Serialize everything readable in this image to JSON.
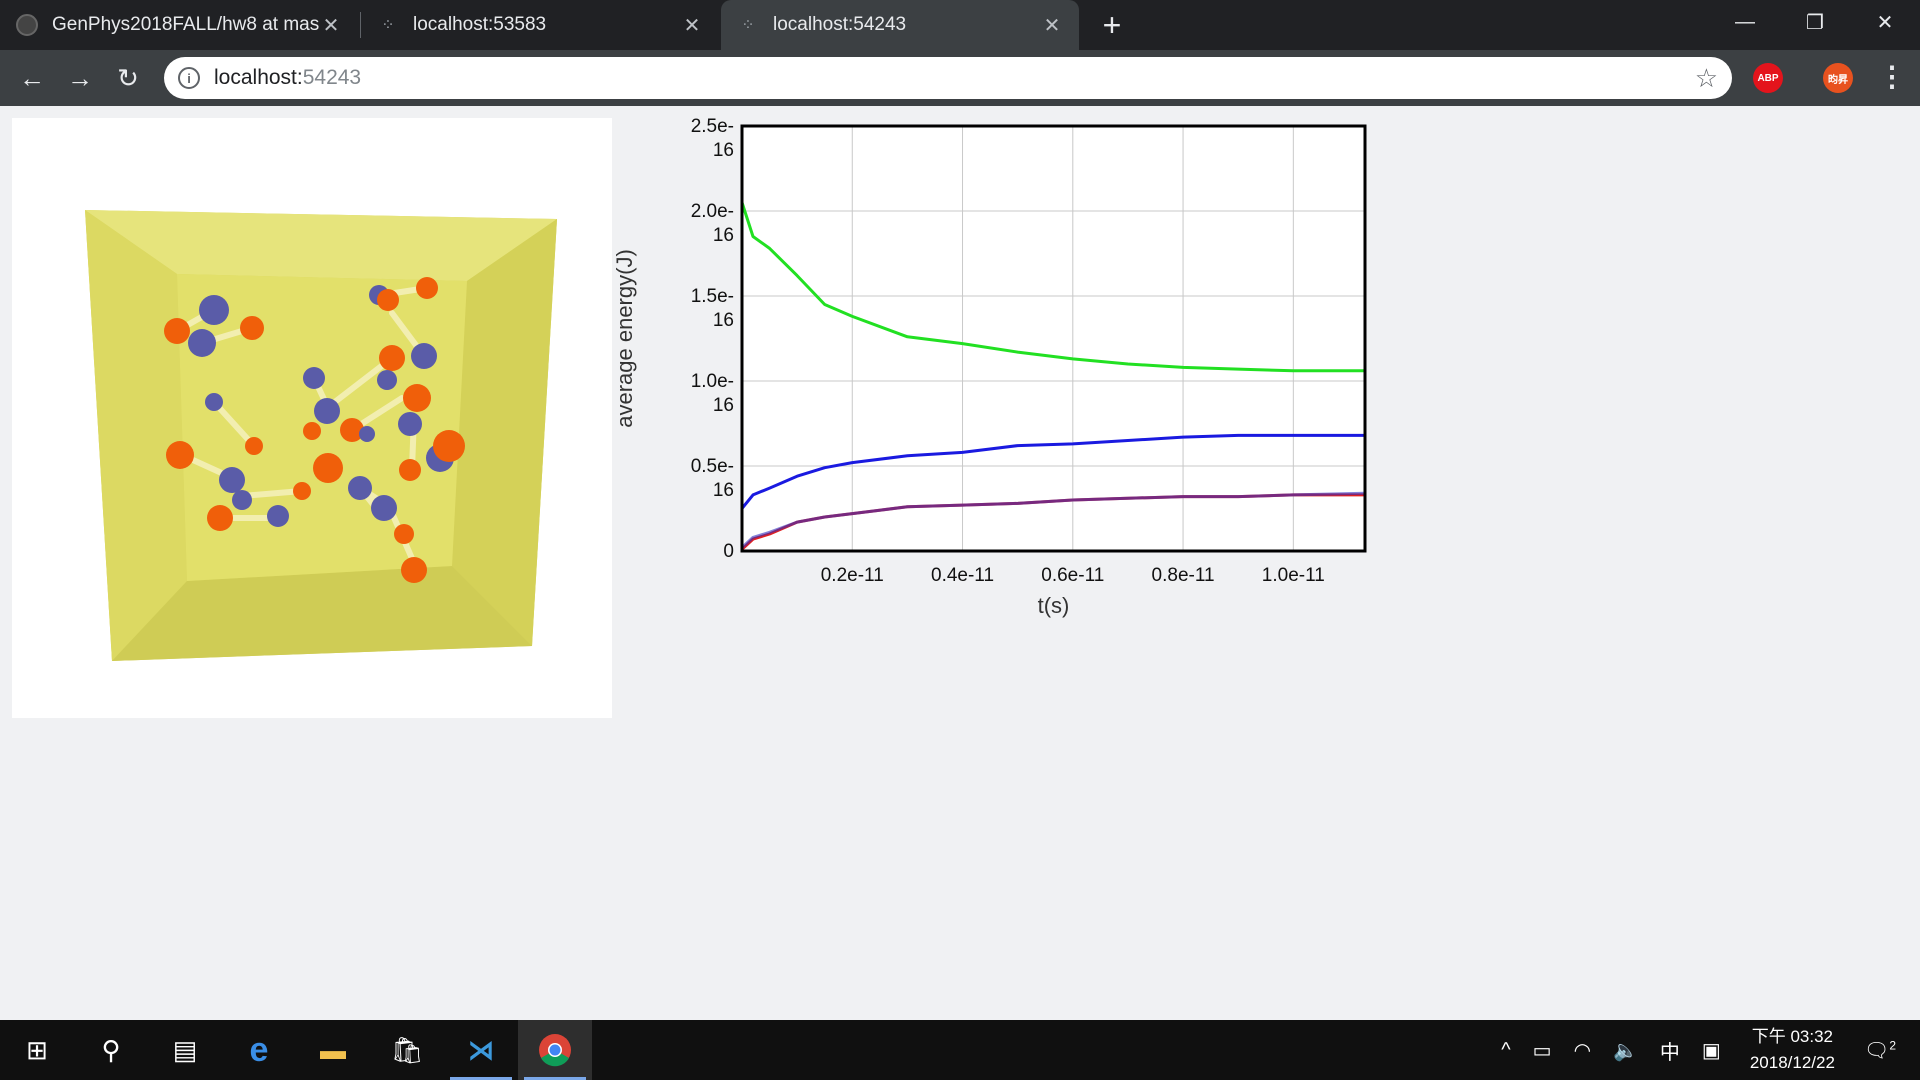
{
  "browser": {
    "tabs": [
      {
        "title": "GenPhys2018FALL/hw8 at mas",
        "active": false,
        "icon": "github-icon"
      },
      {
        "title": "localhost:53583",
        "active": false,
        "icon": "loading-icon"
      },
      {
        "title": "localhost:54243",
        "active": true,
        "icon": "loading-icon"
      }
    ],
    "url_host": "localhost:",
    "url_port": "54243",
    "extensions": [
      {
        "label": "ABP",
        "color": "#e4141c"
      },
      {
        "label": "昀昇",
        "color": "#e8521f"
      }
    ]
  },
  "scene": {
    "description_icon": "molecule-box-3d",
    "box_color": "#e2e06a",
    "atom_colors": {
      "orange": "#f05f0a",
      "blue": "#5a5ca8"
    }
  },
  "chart_data": {
    "type": "line",
    "xlabel": "t(s)",
    "ylabel": "average energy(J)",
    "x_ticks": [
      "0.2e-11",
      "0.4e-11",
      "0.6e-11",
      "0.8e-11",
      "1.0e-11"
    ],
    "y_ticks": [
      "0",
      "0.5e-16",
      "1.0e-16",
      "1.5e-16",
      "2.0e-16",
      "2.5e-16"
    ],
    "xlim": [
      0,
      1.13e-11
    ],
    "ylim": [
      0,
      2.5e-16
    ],
    "grid": true,
    "series": [
      {
        "color": "#22e022",
        "x": [
          0,
          2e-13,
          5e-13,
          1e-12,
          1.5e-12,
          2e-12,
          3e-12,
          4e-12,
          5e-12,
          6e-12,
          7e-12,
          8e-12,
          9e-12,
          1e-11,
          1.13e-11
        ],
        "y": [
          2.05e-16,
          1.85e-16,
          1.78e-16,
          1.62e-16,
          1.45e-16,
          1.38e-16,
          1.26e-16,
          1.22e-16,
          1.17e-16,
          1.13e-16,
          1.1e-16,
          1.08e-16,
          1.07e-16,
          1.06e-16,
          1.06e-16
        ]
      },
      {
        "color": "#1a1ae0",
        "x": [
          0,
          2e-13,
          5e-13,
          1e-12,
          1.5e-12,
          2e-12,
          3e-12,
          4e-12,
          5e-12,
          6e-12,
          7e-12,
          8e-12,
          9e-12,
          1e-11,
          1.13e-11
        ],
        "y": [
          2.5e-17,
          3.3e-17,
          3.7e-17,
          4.4e-17,
          4.9e-17,
          5.2e-17,
          5.6e-17,
          5.8e-17,
          6.2e-17,
          6.3e-17,
          6.5e-17,
          6.7e-17,
          6.8e-17,
          6.8e-17,
          6.8e-17
        ]
      },
      {
        "color": "#e02020",
        "x": [
          0,
          2e-13,
          5e-13,
          1e-12,
          1.5e-12,
          2e-12,
          3e-12,
          4e-12,
          5e-12,
          6e-12,
          7e-12,
          8e-12,
          9e-12,
          1e-11,
          1.13e-11
        ],
        "y": [
          1e-18,
          7e-18,
          1e-17,
          1.7e-17,
          2e-17,
          2.2e-17,
          2.6e-17,
          2.7e-17,
          2.8e-17,
          3e-17,
          3.1e-17,
          3.2e-17,
          3.2e-17,
          3.3e-17,
          3.3e-17
        ]
      },
      {
        "color": "#3030c0",
        "x": [
          0,
          2e-13,
          5e-13,
          1e-12,
          1.5e-12,
          2e-12,
          3e-12,
          4e-12,
          5e-12,
          6e-12,
          7e-12,
          8e-12,
          9e-12,
          1e-11,
          1.13e-11
        ],
        "y": [
          2e-18,
          8e-18,
          1.1e-17,
          1.7e-17,
          2e-17,
          2.2e-17,
          2.6e-17,
          2.7e-17,
          2.8e-17,
          3e-17,
          3.1e-17,
          3.2e-17,
          3.2e-17,
          3.3e-17,
          3.4e-17
        ]
      }
    ]
  },
  "taskbar": {
    "apps": [
      "windows-start-icon",
      "search-icon",
      "task-view-icon",
      "edge-icon",
      "file-explorer-icon",
      "store-icon",
      "vscode-icon",
      "chrome-icon"
    ],
    "clock_period": "下午 03:32",
    "clock_date": "2018/12/22",
    "ime": "中",
    "notification_count": "2"
  }
}
